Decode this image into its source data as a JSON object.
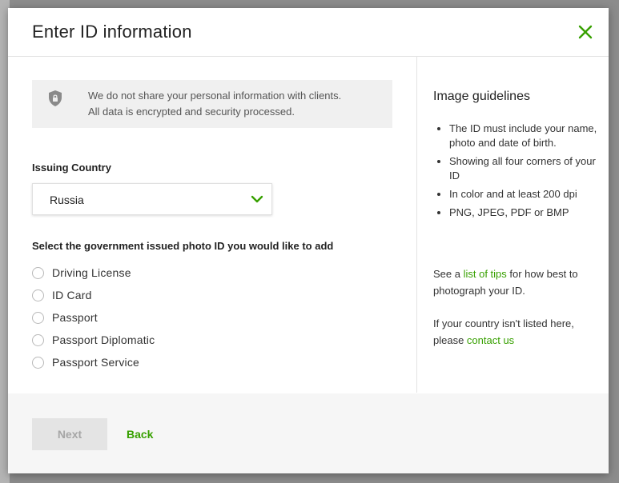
{
  "modal": {
    "title": "Enter ID information",
    "close_icon": "close-icon"
  },
  "notice": {
    "icon": "shield-lock-icon",
    "line1": "We do not share your personal information with clients.",
    "line2": "All data is encrypted and security processed."
  },
  "country": {
    "label": "Issuing Country",
    "selected": "Russia",
    "icon": "chevron-down-icon"
  },
  "id_type": {
    "prompt": "Select the government issued photo ID you would like to add",
    "options": [
      {
        "label": "Driving License",
        "checked": false
      },
      {
        "label": "ID Card",
        "checked": false
      },
      {
        "label": "Passport",
        "checked": false
      },
      {
        "label": "Passport Diplomatic",
        "checked": false
      },
      {
        "label": "Passport Service",
        "checked": false
      }
    ]
  },
  "guidelines": {
    "title": "Image guidelines",
    "items": [
      "The ID must include your name, photo and date of birth.",
      "Showing all four corners of your ID",
      "In color and at least 200 dpi",
      "PNG, JPEG, PDF or BMP"
    ],
    "tips_prefix": "See a ",
    "tips_link": "list of tips",
    "tips_suffix": " for how best to photograph your ID.",
    "contact_prefix": "If your country isn't listed here, please ",
    "contact_link": "contact us"
  },
  "footer": {
    "next_label": "Next",
    "back_label": "Back"
  },
  "colors": {
    "accent": "#37a000",
    "backdrop": "#8c8c8c"
  }
}
